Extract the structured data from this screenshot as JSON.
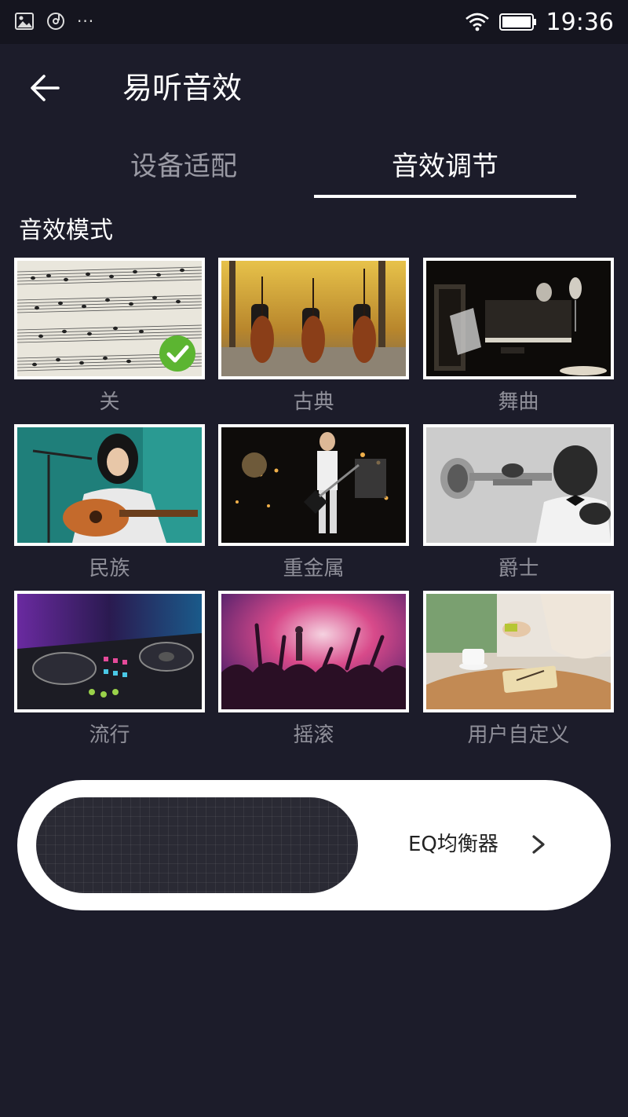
{
  "status_bar": {
    "time": "19:36",
    "icons": [
      "image-icon",
      "music-disc-icon",
      "more-dots-icon",
      "wifi-icon",
      "battery-icon"
    ],
    "overflow_dots": "···"
  },
  "header": {
    "title": "易听音效",
    "back_icon": "arrow-left-icon"
  },
  "tabs": [
    {
      "label": "设备适配",
      "active": false
    },
    {
      "label": "音效调节",
      "active": true
    }
  ],
  "section": {
    "title": "音效模式"
  },
  "modes": [
    {
      "label": "关",
      "selected": true
    },
    {
      "label": "古典",
      "selected": false
    },
    {
      "label": "舞曲",
      "selected": false
    },
    {
      "label": "民族",
      "selected": false
    },
    {
      "label": "重金属",
      "selected": false
    },
    {
      "label": "爵士",
      "selected": false
    },
    {
      "label": "流行",
      "selected": false
    },
    {
      "label": "摇滚",
      "selected": false
    },
    {
      "label": "用户自定义",
      "selected": false
    }
  ],
  "eq": {
    "label": "EQ均衡器",
    "chevron_icon": "chevron-right-icon"
  },
  "colors": {
    "background": "#1c1c2a",
    "accent_check": "#5cb531",
    "inactive_text": "#9a9aa4"
  }
}
